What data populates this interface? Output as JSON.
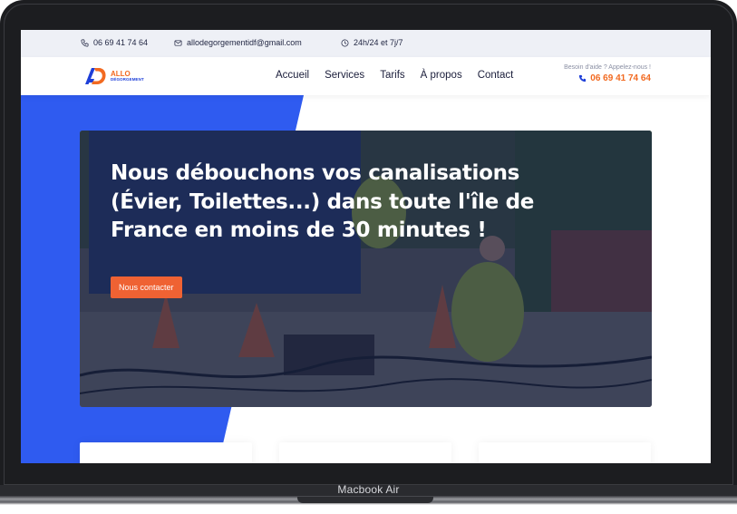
{
  "device": {
    "label": "Macbook Air"
  },
  "topbar": {
    "phone": "06 69 41 74 64",
    "email": "allodegorgementidf@gmail.com",
    "hours": "24h/24 et 7j/7"
  },
  "navbar": {
    "logo": {
      "line1": "ALLO",
      "line2": "DÉGORGEMENT"
    },
    "links": [
      "Accueil",
      "Services",
      "Tarifs",
      "À propos",
      "Contact"
    ],
    "help_label": "Besoin d'aide ? Appelez-nous !",
    "help_phone": "06 69 41 74 64"
  },
  "hero": {
    "title": "Nous débouchons vos canalisations (Évier, Toilettes...) dans toute l'île de France en moins de 30 minutes !",
    "cta": "Nous contacter"
  },
  "colors": {
    "accent_orange": "#f26a21",
    "brand_blue": "#2f5bf0",
    "dark_text": "#1a1d3a"
  },
  "icons": [
    "phone-icon",
    "mail-icon",
    "clock-icon",
    "phone-icon"
  ]
}
